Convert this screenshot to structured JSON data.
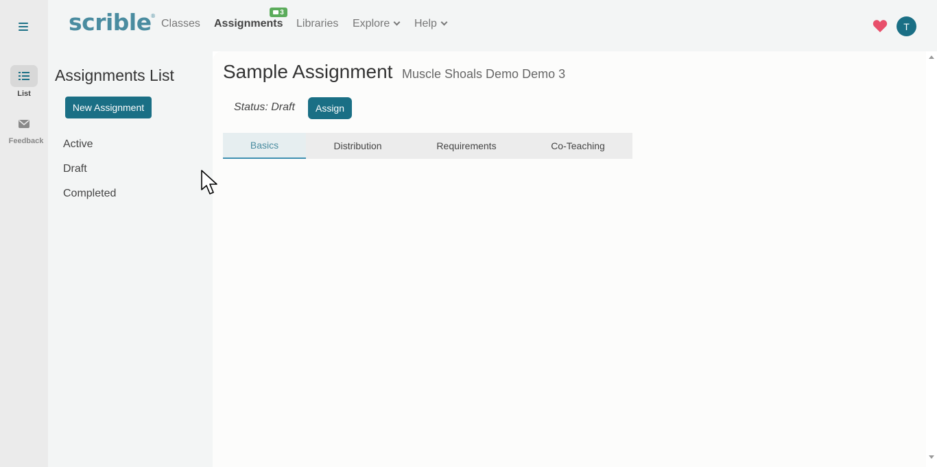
{
  "rail": {
    "list_label": "List",
    "feedback_label": "Feedback"
  },
  "topbar": {
    "logo": "scrible",
    "logo_mark": "®",
    "nav": {
      "classes": "Classes",
      "assignments": "Assignments",
      "libraries": "Libraries",
      "explore": "Explore",
      "help": "Help"
    },
    "assignments_badge": "3",
    "avatar_initial": "T"
  },
  "sidebar": {
    "title": "Assignments List",
    "new_button": "New Assignment",
    "filters": [
      "Active",
      "Draft",
      "Completed"
    ]
  },
  "main": {
    "title": "Sample Assignment",
    "subtitle": "Muscle Shoals Demo Demo 3",
    "status": "Status: Draft",
    "assign_button": "Assign",
    "tabs": [
      "Basics",
      "Distribution",
      "Requirements",
      "Co-Teaching"
    ],
    "active_tab": "Basics"
  },
  "colors": {
    "brand": "#1a6f85",
    "logo": "#4a8ca0",
    "badge": "#5bac5b",
    "heart": "#e8506b"
  }
}
